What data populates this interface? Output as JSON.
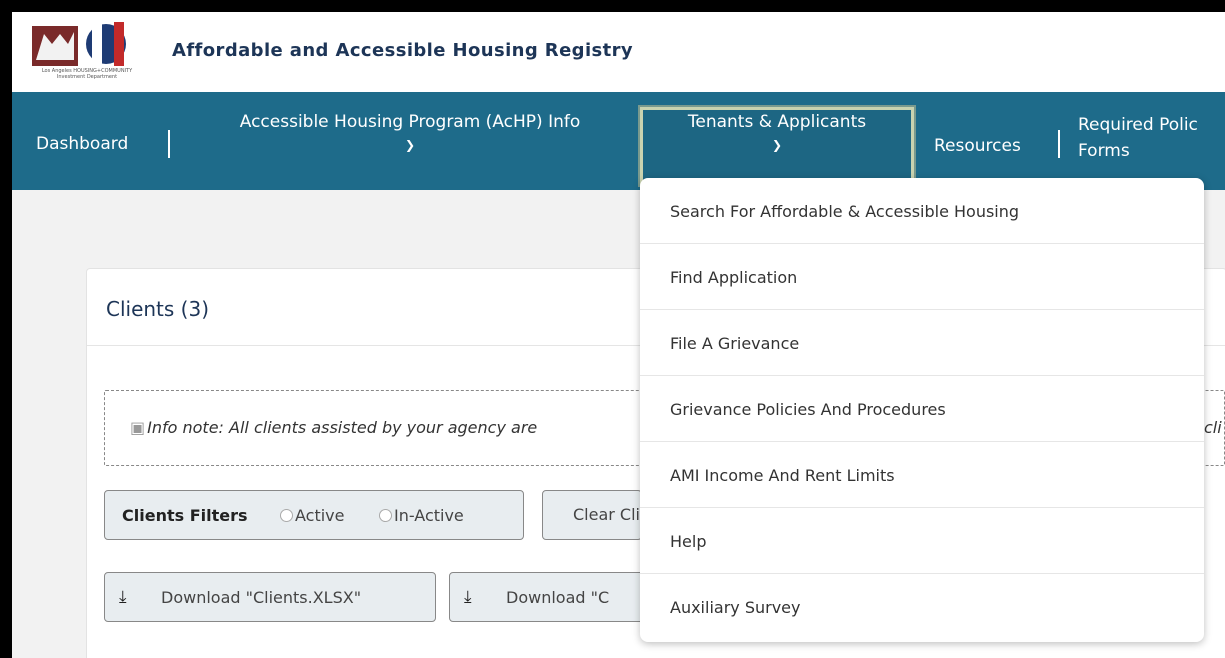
{
  "header": {
    "logo_text": "Los Angeles HOUSING+COMMUNITY Investment Department",
    "title": "Affordable and Accessible Housing Registry"
  },
  "nav": {
    "dashboard": "Dashboard",
    "achp_info": "Accessible Housing Program (AcHP) Info",
    "tenants": "Tenants & Applicants",
    "resources": "Resources",
    "required_line1": "Required Polic",
    "required_line2": "Forms",
    "chevron_icon": "chevron-down-icon"
  },
  "dropdown": {
    "items": [
      "Search For Affordable & Accessible Housing",
      "Find Application",
      "File A Grievance",
      "Grievance Policies And Procedures",
      "AMI Income And Rent Limits",
      "Help",
      "Auxiliary Survey"
    ]
  },
  "clients": {
    "title": "Clients (3)",
    "note_icon_alt": "Info note:",
    "note_text": "All clients assisted by your agency are",
    "note_right": "cli",
    "filters_label": "Clients Filters",
    "active_label": "Active",
    "inactive_label": "In-Active",
    "clear_label": "Clear Cli",
    "download_xlsx": "Download \"Clients.XLSX\"",
    "download_other": "Download \"C"
  },
  "colors": {
    "nav_bg": "#1e6b8a",
    "title_color": "#1d3557"
  }
}
